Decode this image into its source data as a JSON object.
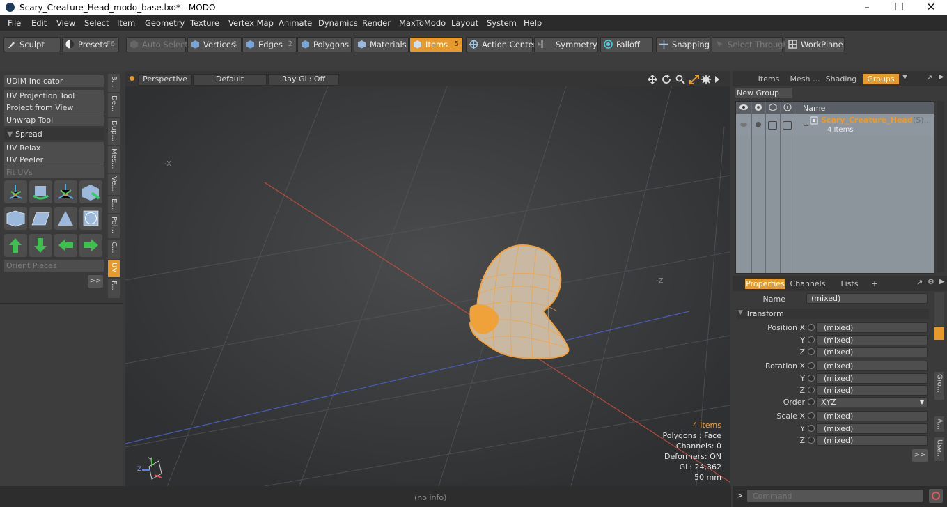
{
  "window": {
    "title": "Scary_Creature_Head_modo_base.lxo* - MODO"
  },
  "menu": [
    "File",
    "Edit",
    "View",
    "Select",
    "Item",
    "Geometry",
    "Texture",
    "Vertex Map",
    "Animate",
    "Dynamics",
    "Render",
    "MaxToModo",
    "Layout",
    "System",
    "Help"
  ],
  "toolbar": {
    "sculpt": "Sculpt",
    "presets": "Presets",
    "presets_key": "F6",
    "auto_select": "Auto Select",
    "vertices": "Vertices",
    "vertices_num": "1",
    "edges": "Edges",
    "edges_num": "2",
    "polygons": "Polygons",
    "materials": "Materials",
    "items": "Items",
    "items_num": "5",
    "action_center": "Action Center",
    "symmetry": "Symmetry",
    "falloff": "Falloff",
    "snapping": "Snapping",
    "select_through": "Select Through",
    "workplane": "WorkPlane"
  },
  "left_panel": {
    "tools": [
      "UDIM Indicator",
      "UV Projection Tool",
      "Project from View",
      "Unwrap Tool"
    ],
    "spread_header": "Spread",
    "tools2": [
      "UV Relax",
      "UV Peeler",
      "Fit UVs"
    ],
    "orient": "Orient Pieces",
    "more": ">>",
    "vertical_tabs": [
      "B...",
      "De...",
      "Dup...",
      "Mes...",
      "Ve...",
      "E...",
      "Pol...",
      "C...",
      "UV",
      "F..."
    ]
  },
  "viewport": {
    "perspective": "Perspective",
    "default": "Default",
    "raygl": "Ray GL: Off",
    "axis_neg_x": "-X",
    "axis_neg_z": "-Z",
    "stats": {
      "items": "4 Items",
      "polygons": "Polygons : Face",
      "channels": "Channels: 0",
      "deformers": "Deformers: ON",
      "gl": "GL: 24,362",
      "mm": "50 mm"
    },
    "axes": {
      "x": "X",
      "y": "Y",
      "z": "Z"
    }
  },
  "status": {
    "text": "(no info)"
  },
  "groups_panel": {
    "tabs": [
      "Items",
      "Mesh ...",
      "Shading",
      "Groups"
    ],
    "new_group": "New Group",
    "col_name": "Name",
    "group_name": "Scary_Creature_Head",
    "group_suffix": "(S)...",
    "group_count": "4 Items"
  },
  "properties": {
    "tabs": [
      "Properties",
      "Channels",
      "Lists",
      "+"
    ],
    "name_label": "Name",
    "name_value": "(mixed)",
    "transform": "Transform",
    "position_x": "Position X",
    "rotation_x": "Rotation X",
    "scale_x": "Scale X",
    "y": "Y",
    "z": "Z",
    "order_label": "Order",
    "order_value": "XYZ",
    "mixed": "(mixed)",
    "more": ">>",
    "side_tabs": [
      "Gro...",
      "A...",
      "Use..."
    ]
  },
  "command": {
    "placeholder": "Command",
    "prompt": ">"
  },
  "colors": {
    "accent": "#e69a2b",
    "bg": "#3a3a3a",
    "viewport": "#3c3d3f"
  }
}
